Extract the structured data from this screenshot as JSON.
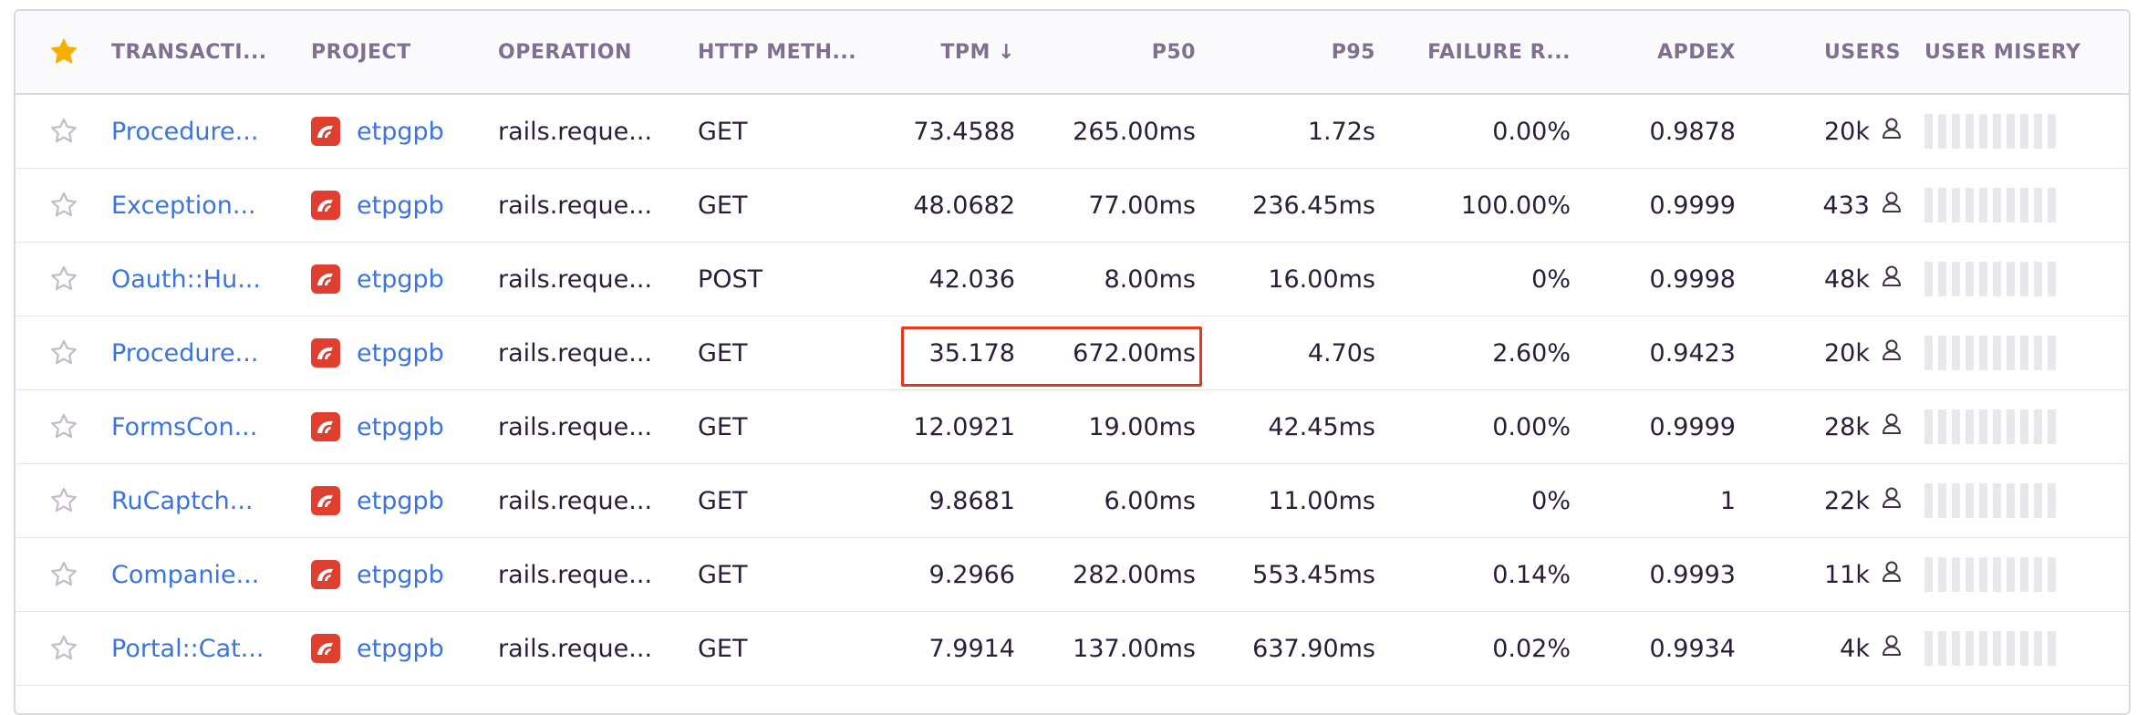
{
  "table": {
    "columns": {
      "transaction": "TRANSACTI...",
      "project": "PROJECT",
      "operation": "OPERATION",
      "http_method": "HTTP METH...",
      "tpm": "TPM ↓",
      "p50": "P50",
      "p95": "P95",
      "failure_rate": "FAILURE R...",
      "apdex": "APDEX",
      "users": "USERS",
      "user_misery": "USER MISERY"
    },
    "rows": [
      {
        "transaction": "Procedure...",
        "project": "etpgpb",
        "operation": "rails.reque...",
        "method": "GET",
        "tpm": "73.4588",
        "p50": "265.00ms",
        "p95": "1.72s",
        "failure": "0.00%",
        "apdex": "0.9878",
        "users": "20k"
      },
      {
        "transaction": "Exception...",
        "project": "etpgpb",
        "operation": "rails.reque...",
        "method": "GET",
        "tpm": "48.0682",
        "p50": "77.00ms",
        "p95": "236.45ms",
        "failure": "100.00%",
        "apdex": "0.9999",
        "users": "433"
      },
      {
        "transaction": "Oauth::Hu...",
        "project": "etpgpb",
        "operation": "rails.reque...",
        "method": "POST",
        "tpm": "42.036",
        "p50": "8.00ms",
        "p95": "16.00ms",
        "failure": "0%",
        "apdex": "0.9998",
        "users": "48k"
      },
      {
        "transaction": "Procedure...",
        "project": "etpgpb",
        "operation": "rails.reque...",
        "method": "GET",
        "tpm": "35.178",
        "p50": "672.00ms",
        "p95": "4.70s",
        "failure": "2.60%",
        "apdex": "0.9423",
        "users": "20k"
      },
      {
        "transaction": "FormsCon...",
        "project": "etpgpb",
        "operation": "rails.reque...",
        "method": "GET",
        "tpm": "12.0921",
        "p50": "19.00ms",
        "p95": "42.45ms",
        "failure": "0.00%",
        "apdex": "0.9999",
        "users": "28k"
      },
      {
        "transaction": "RuCaptch...",
        "project": "etpgpb",
        "operation": "rails.reque...",
        "method": "GET",
        "tpm": "9.8681",
        "p50": "6.00ms",
        "p95": "11.00ms",
        "failure": "0%",
        "apdex": "1",
        "users": "22k"
      },
      {
        "transaction": "Companie...",
        "project": "etpgpb",
        "operation": "rails.reque...",
        "method": "GET",
        "tpm": "9.2966",
        "p50": "282.00ms",
        "p95": "553.45ms",
        "failure": "0.14%",
        "apdex": "0.9993",
        "users": "11k"
      },
      {
        "transaction": "Portal::Cat...",
        "project": "etpgpb",
        "operation": "rails.reque...",
        "method": "GET",
        "tpm": "7.9914",
        "p50": "137.00ms",
        "p95": "637.90ms",
        "failure": "0.02%",
        "apdex": "0.9934",
        "users": "4k"
      }
    ]
  },
  "colors": {
    "link": "#3c74dd",
    "project_badge": "#e03e2f",
    "header_text": "#80708f",
    "star_filled": "#f5b000",
    "highlight_border": "#e8381b"
  },
  "icons": {
    "header_star": "star-filled-icon",
    "row_star": "star-outline-icon",
    "project": "project-logo-icon",
    "users": "user-icon"
  }
}
